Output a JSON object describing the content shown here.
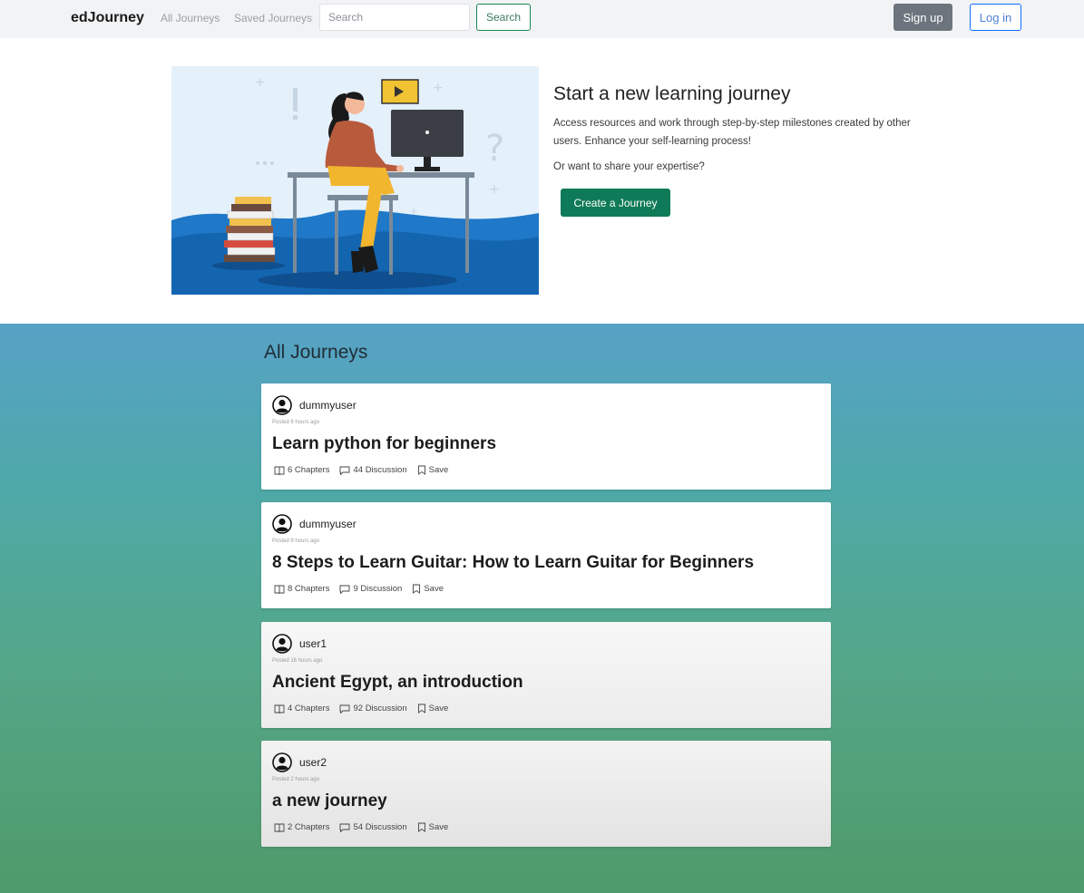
{
  "navbar": {
    "brand": "edJourney",
    "links": [
      "All Journeys",
      "Saved Journeys"
    ],
    "search_placeholder": "Search",
    "search_button": "Search",
    "signup_button": "Sign up",
    "login_button": "Log in"
  },
  "hero": {
    "title": "Start a new learning journey",
    "description": "Access resources and work through step-by-step milestones created by other users. Enhance your self-learning process!",
    "share_prompt": "Or want to share your expertise?",
    "create_button": "Create a Journey"
  },
  "journeys": {
    "section_title": "All Journeys",
    "items": [
      {
        "user": "dummyuser",
        "posted": "Posted 6 hours ago",
        "title": "Learn python for beginners",
        "chapters": "6 Chapters",
        "discussion": "44 Discussion",
        "save": "Save"
      },
      {
        "user": "dummyuser",
        "posted": "Posted 9 hours ago",
        "title": "8 Steps to Learn Guitar: How to Learn Guitar for Beginners",
        "chapters": "8 Chapters",
        "discussion": "9 Discussion",
        "save": "Save"
      },
      {
        "user": "user1",
        "posted": "Posted 16 hours ago",
        "title": "Ancient Egypt, an introduction",
        "chapters": "4 Chapters",
        "discussion": "92 Discussion",
        "save": "Save"
      },
      {
        "user": "user2",
        "posted": "Posted 2 hours ago",
        "title": "a new journey",
        "chapters": "2 Chapters",
        "discussion": "54 Discussion",
        "save": "Save"
      }
    ]
  },
  "colors": {
    "primary_green": "#0f7a57",
    "navbar_bg": "#f2f3f5",
    "gradient_top": "#57a2c6",
    "gradient_bottom": "#4f9a6a"
  },
  "icons": [
    "user-circle-icon",
    "book-icon",
    "comment-icon",
    "bookmark-icon"
  ]
}
